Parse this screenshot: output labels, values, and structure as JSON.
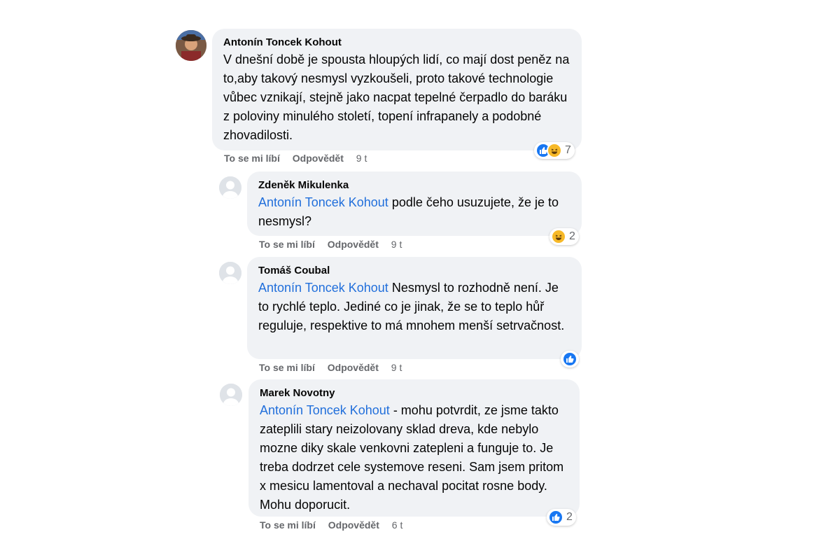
{
  "comments": [
    {
      "author": "Antonín Toncek Kohout",
      "text": "V dnešní době je spousta hloupých lidí, co mají dost peněz na to,aby takový nesmysl vyzkoušeli, proto takové technologie vůbec vznikají, stejně jako nacpat tepelné čerpadlo do baráku z poloviny minulého století, topení infrapanely a podobné zhovadilosti.",
      "like_label": "To se mi líbí",
      "reply_label": "Odpovědět",
      "time": "9 t",
      "reactions": [
        "like-icon",
        "haha-icon"
      ],
      "reaction_count": "7"
    },
    {
      "author": "Zdeněk Mikulenka",
      "mention": "Antonín Toncek Kohout",
      "text": " podle čeho usuzujete, že je to nesmysl?",
      "like_label": "To se mi líbí",
      "reply_label": "Odpovědět",
      "time": "9 t",
      "reactions": [
        "haha-icon"
      ],
      "reaction_count": "2"
    },
    {
      "author": "Tomáš Coubal",
      "mention": "Antonín Toncek Kohout",
      "text": " Nesmysl to rozhodně není. Je to rychlé teplo. Jediné co je jinak, že se to teplo hůř reguluje, respektive to má mnohem menší setrvačnost.",
      "like_label": "To se mi líbí",
      "reply_label": "Odpovědět",
      "time": "9 t",
      "reactions": [
        "like-icon"
      ],
      "reaction_count": ""
    },
    {
      "author": "Marek Novotny",
      "mention": "Antonín Toncek Kohout",
      "text": " - mohu potvrdit, ze jsme takto zateplili stary neizolovany sklad dreva, kde nebylo mozne diky skale venkovni zatepleni a funguje to. Je treba dodrzet cele systemove reseni. Sam jsem pritom x mesicu lamentoval a nechaval pocitat rosne body. Mohu doporucit.",
      "like_label": "To se mi líbí",
      "reply_label": "Odpovědět",
      "time": "6 t",
      "reactions": [
        "like-icon"
      ],
      "reaction_count": "2"
    }
  ],
  "colors": {
    "mention": "#216fdb",
    "like": "#1877f2",
    "haha": "#f7b928",
    "bubble": "#f0f2f5"
  }
}
